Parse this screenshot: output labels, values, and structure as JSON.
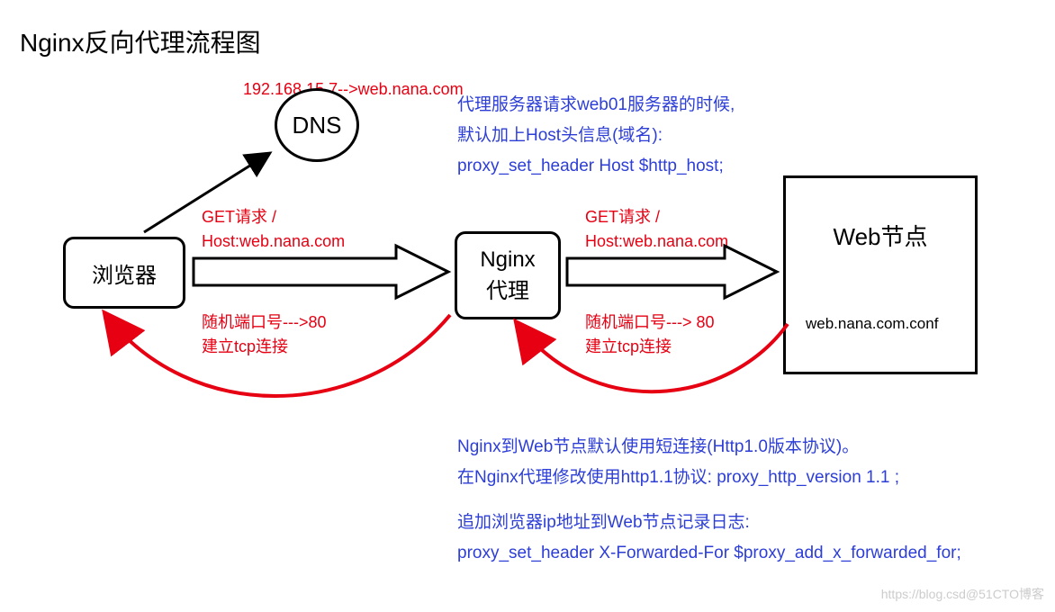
{
  "title": "Nginx反向代理流程图",
  "dns_mapping": "192.168.15.7-->web.nana.com",
  "nodes": {
    "browser": "浏览器",
    "dns": "DNS",
    "proxy_line1": "Nginx",
    "proxy_line2": "代理",
    "web": "Web节点"
  },
  "req1_line1": "GET请求 /",
  "req1_line2": "Host:web.nana.com",
  "tcp1_line1": "随机端口号--->80",
  "tcp1_line2": "建立tcp连接",
  "req2_line1": "GET请求 /",
  "req2_line2": "Host:web.nana.com",
  "tcp2_line1": "随机端口号---> 80",
  "tcp2_line2": "建立tcp连接",
  "conf_file": "web.nana.com.conf",
  "note_top_1": "代理服务器请求web01服务器的时候,",
  "note_top_2": "默认加上Host头信息(域名):",
  "note_top_3": "proxy_set_header Host $http_host;",
  "note_bot_1": "Nginx到Web节点默认使用短连接(Http1.0版本协议)。",
  "note_bot_2": "在Nginx代理修改使用http1.1协议: proxy_http_version 1.1 ;",
  "note_bot_3": "追加浏览器ip地址到Web节点记录日志:",
  "note_bot_4": "proxy_set_header X-Forwarded-For $proxy_add_x_forwarded_for;",
  "watermark": "https://blog.csd@51CTO博客"
}
